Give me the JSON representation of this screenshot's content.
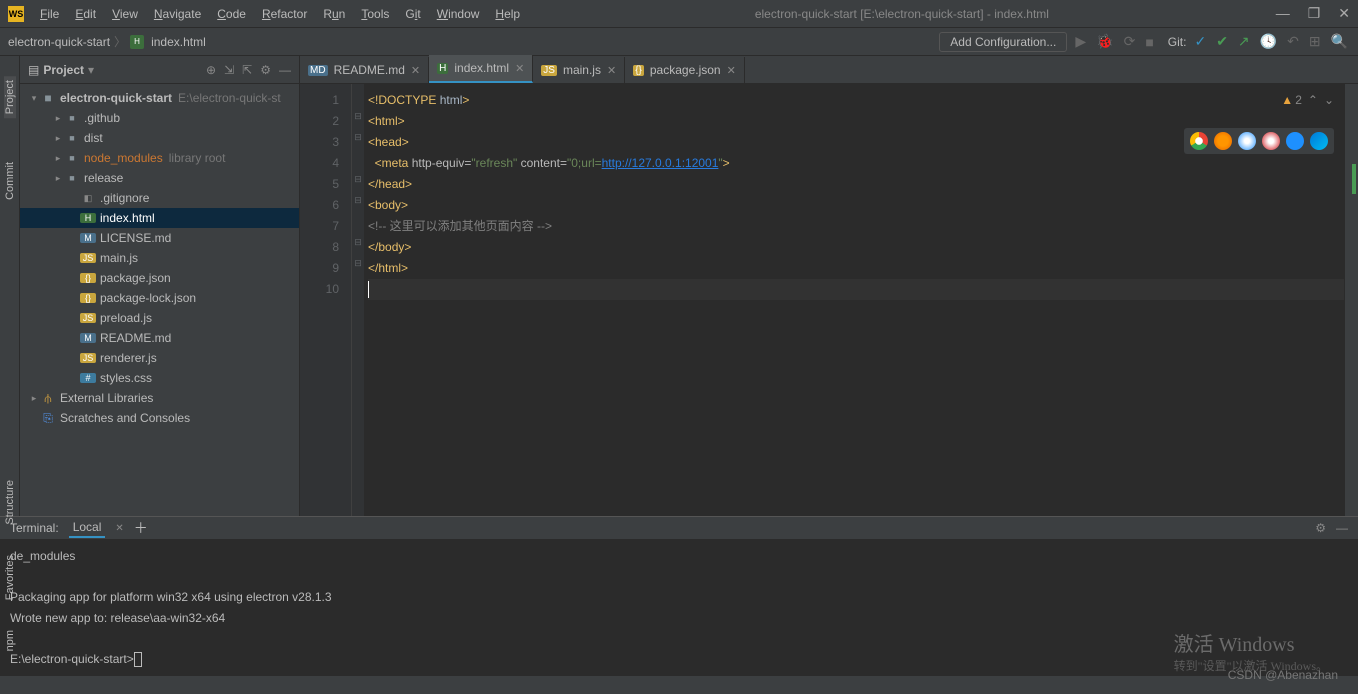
{
  "window": {
    "title": "electron-quick-start [E:\\electron-quick-start] - index.html",
    "logo": "WS"
  },
  "menu": [
    "File",
    "Edit",
    "View",
    "Navigate",
    "Code",
    "Refactor",
    "Run",
    "Tools",
    "Git",
    "Window",
    "Help"
  ],
  "breadcrumb": {
    "root": "electron-quick-start",
    "file": "index.html"
  },
  "toolbar": {
    "addConfig": "Add Configuration...",
    "gitLabel": "Git:"
  },
  "leftTabs": [
    "Project",
    "Commit",
    "Structure",
    "Favorites",
    "npm"
  ],
  "projectPanel": {
    "title": "Project"
  },
  "tree": {
    "root": "electron-quick-start",
    "rootPath": "E:\\electron-quick-st",
    "items": [
      {
        "name": ".github",
        "type": "folder",
        "indent": 2,
        "arrow": "▸"
      },
      {
        "name": "dist",
        "type": "folder",
        "indent": 2,
        "arrow": "▸"
      },
      {
        "name": "node_modules",
        "type": "folder",
        "indent": 2,
        "arrow": "▸",
        "orange": true,
        "note": "library root"
      },
      {
        "name": "release",
        "type": "folder",
        "indent": 2,
        "arrow": "▸"
      },
      {
        "name": ".gitignore",
        "type": "file",
        "indent": 3
      },
      {
        "name": "index.html",
        "type": "html",
        "indent": 3,
        "selected": true
      },
      {
        "name": "LICENSE.md",
        "type": "md",
        "indent": 3
      },
      {
        "name": "main.js",
        "type": "js",
        "indent": 3
      },
      {
        "name": "package.json",
        "type": "json",
        "indent": 3
      },
      {
        "name": "package-lock.json",
        "type": "json",
        "indent": 3
      },
      {
        "name": "preload.js",
        "type": "js",
        "indent": 3
      },
      {
        "name": "README.md",
        "type": "md",
        "indent": 3
      },
      {
        "name": "renderer.js",
        "type": "js",
        "indent": 3
      },
      {
        "name": "styles.css",
        "type": "css",
        "indent": 3
      }
    ],
    "extLibs": "External Libraries",
    "scratches": "Scratches and Consoles"
  },
  "tabs": [
    {
      "name": "README.md",
      "icon": "MD"
    },
    {
      "name": "index.html",
      "icon": "H",
      "active": true
    },
    {
      "name": "main.js",
      "icon": "JS"
    },
    {
      "name": "package.json",
      "icon": "{}"
    }
  ],
  "warnings": "2",
  "code": {
    "l1a": "<!DOCTYPE ",
    "l1b": "html",
    "l1c": ">",
    "l2a": "<html>",
    "l3a": "<head>",
    "l4a": "  <meta ",
    "l4b": "http-equiv=",
    "l4c": "\"refresh\"",
    "l4d": " content=",
    "l4e": "\"0;url=",
    "l4link": "http://127.0.0.1:12001",
    "l4f": "\"",
    "l4g": ">",
    "l5a": "</head>",
    "l6a": "<body>",
    "l7a": "<!-- 这里可以添加其他页面内容 -->",
    "l8a": "</body>",
    "l9a": "</html>"
  },
  "terminal": {
    "label": "Terminal:",
    "tab": "Local",
    "line1": "de_modules",
    "line2": "Packaging app for platform win32 x64 using electron v28.1.3",
    "line3": "Wrote new app to: release\\aa-win32-x64",
    "prompt": "E:\\electron-quick-start>"
  },
  "watermark": {
    "title": "激活 Windows",
    "sub": "转到\"设置\"以激活 Windows。"
  },
  "csdn": "CSDN @Abenazhan"
}
